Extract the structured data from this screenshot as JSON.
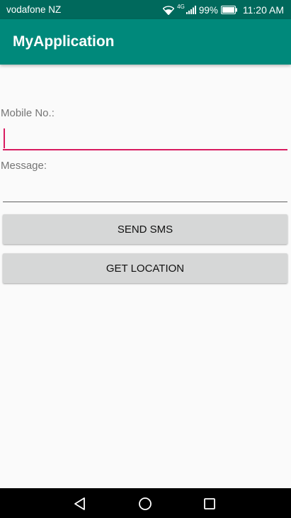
{
  "status_bar": {
    "carrier": "vodafone NZ",
    "network_type": "4G",
    "battery_percent": "99%",
    "time": "11:20 AM"
  },
  "app_bar": {
    "title": "MyApplication"
  },
  "form": {
    "mobile_label": "Mobile No.:",
    "mobile_value": "",
    "message_label": "Message:",
    "message_value": ""
  },
  "buttons": {
    "send_sms": "SEND SMS",
    "get_location": "GET LOCATION"
  },
  "nav_bar": {
    "back_icon": "back-triangle-icon",
    "home_icon": "home-circle-icon",
    "recents_icon": "recents-square-icon"
  },
  "colors": {
    "status_bar": "#00695c",
    "app_bar": "#00897b",
    "accent": "#d81b60",
    "background": "#fafafa",
    "button": "#d6d7d7"
  }
}
